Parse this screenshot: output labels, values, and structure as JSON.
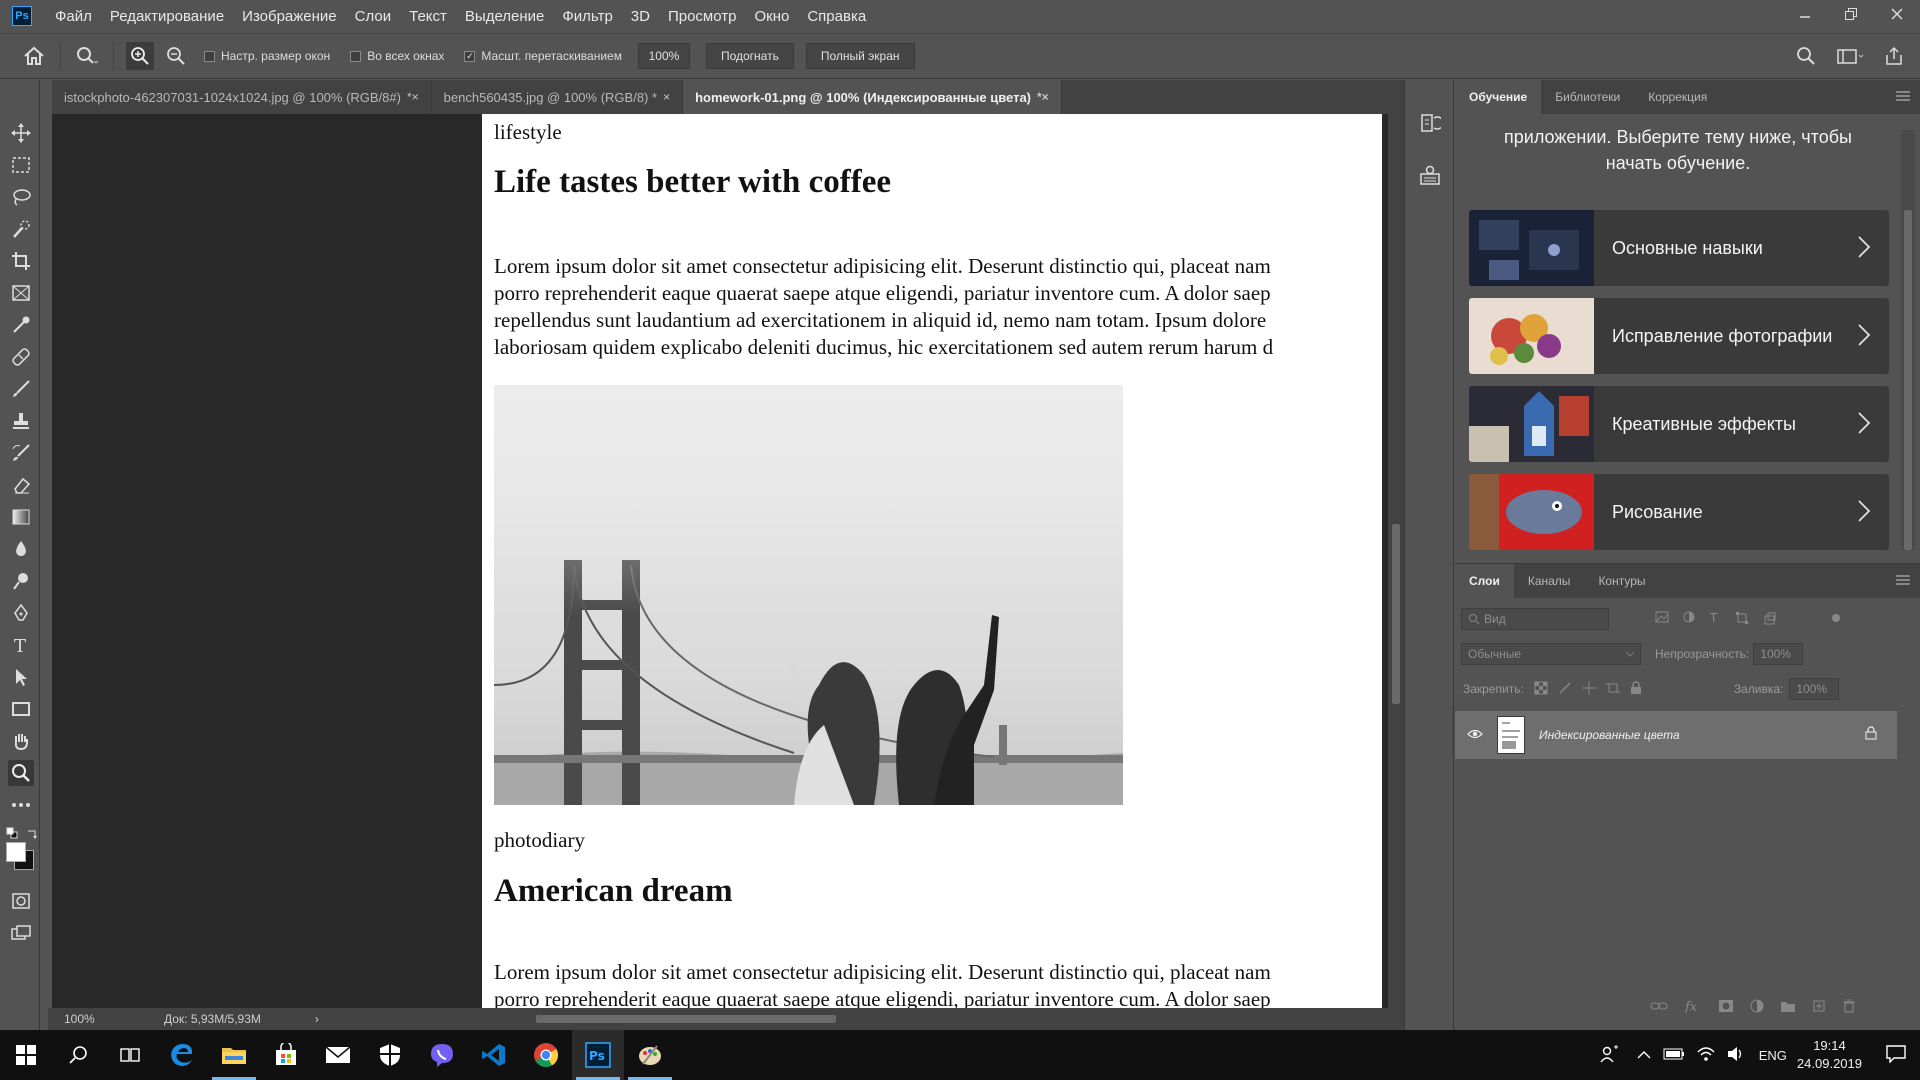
{
  "app": {
    "logo": "Ps"
  },
  "menu": [
    "Файл",
    "Редактирование",
    "Изображение",
    "Слои",
    "Текст",
    "Выделение",
    "Фильтр",
    "3D",
    "Просмотр",
    "Окно",
    "Справка"
  ],
  "options": {
    "check_resize": "Настр. размер окон",
    "check_all_windows": "Во всех окнах",
    "check_scrubby": "Масшт. перетаскиванием",
    "zoom_value": "100%",
    "fit_button": "Подогнать",
    "fullscreen_button": "Полный экран"
  },
  "tabs": [
    {
      "label": "istockphoto-462307031-1024x1024.jpg @ 100% (RGB/8#)",
      "close": "*×"
    },
    {
      "label": "bench560435.jpg @ 100% (RGB/8) *",
      "close": "×"
    },
    {
      "label": "homework-01.png @ 100% (Индексированные цвета)",
      "close": "*×"
    }
  ],
  "document": {
    "category1": "lifestyle",
    "heading1": "Life tastes better with coffee",
    "para1": [
      "Lorem ipsum dolor sit amet consectetur adipisicing elit. Deserunt distinctio qui, placeat nam",
      "porro reprehenderit eaque quaerat saepe atque eligendi, pariatur inventore cum. A dolor saep",
      "repellendus sunt laudantium ad exercitationem in aliquid id, nemo nam totam. Ipsum dolore",
      "laboriosam quidem explicabo deleniti ducimus, hic exercitationem sed autem rerum harum d"
    ],
    "category2": "photodiary",
    "heading2": "American dream",
    "para2": [
      "Lorem ipsum dolor sit amet consectetur adipisicing elit. Deserunt distinctio qui, placeat nam",
      "porro reprehenderit eaque quaerat saepe atque eligendi, pariatur inventore cum. A dolor saep"
    ]
  },
  "status": {
    "zoom": "100%",
    "doc": "Док: 5,93M/5,93M",
    "arrow": "›"
  },
  "learn_panel": {
    "tabs": [
      "Обучение",
      "Библиотеки",
      "Коррекция"
    ],
    "intro_line1": "приложении. Выберите тему ниже, чтобы",
    "intro_line2": "начать обучение.",
    "cards": [
      "Основные навыки",
      "Исправление фотографии",
      "Креативные эффекты",
      "Рисование"
    ]
  },
  "layers_panel": {
    "tabs": [
      "Слои",
      "Каналы",
      "Контуры"
    ],
    "filter_placeholder": "Вид",
    "blend_mode": "Обычные",
    "opacity_label": "Непрозрачность:",
    "opacity_value": "100%",
    "lock_label": "Закрепить:",
    "fill_label": "Заливка:",
    "fill_value": "100%",
    "layer_name": "Индексированные цвета"
  },
  "taskbar": {
    "lang": "ENG",
    "time": "19:14",
    "date": "24.09.2019"
  },
  "colors": {
    "accent": "#31a8ff",
    "panel": "#535353",
    "dark": "#282828",
    "taskbar_indicator": "#76b9ed"
  }
}
